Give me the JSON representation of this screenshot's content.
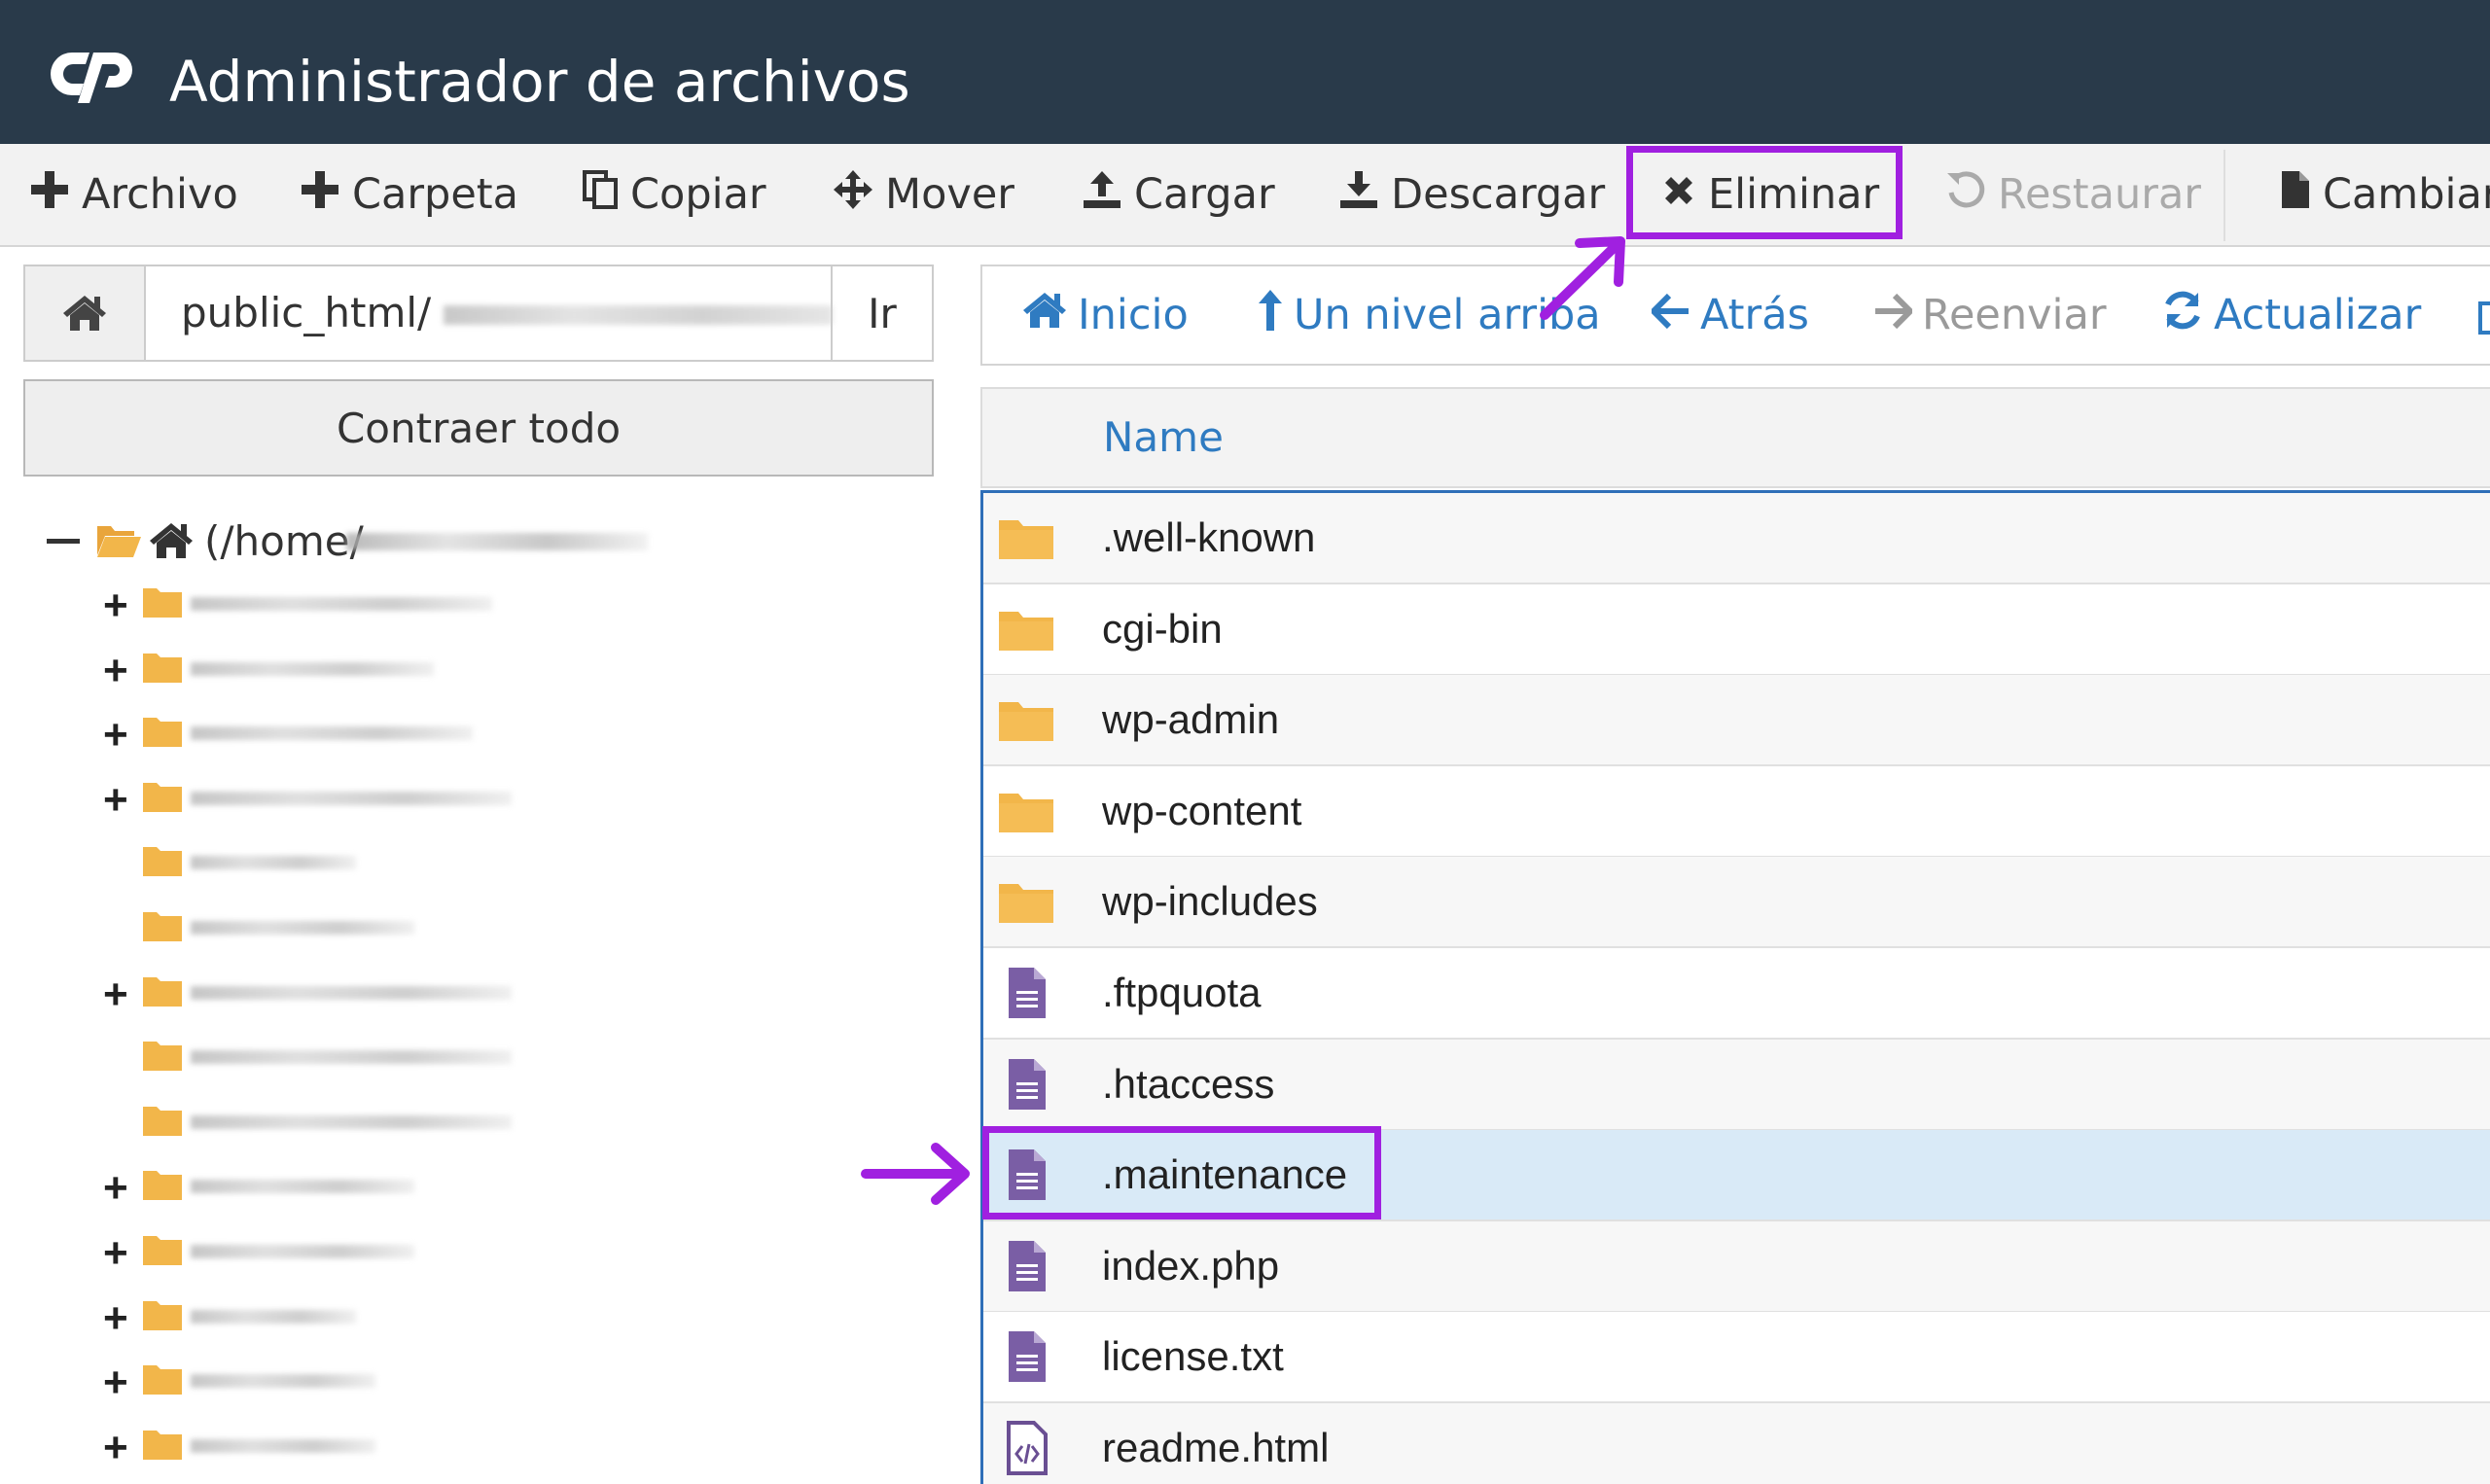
{
  "app": {
    "title": "Administrador de archivos",
    "logo_icon": "cpanel-logo",
    "header_color": "#293a4a",
    "accent_color": "#2f7bc1",
    "highlight_color": "#a020e0"
  },
  "toolbar": {
    "items": [
      {
        "label": "Archivo",
        "icon": "plus-icon",
        "enabled": true
      },
      {
        "label": "Carpeta",
        "icon": "plus-icon",
        "enabled": true
      },
      {
        "label": "Copiar",
        "icon": "copy-icon",
        "enabled": true
      },
      {
        "label": "Mover",
        "icon": "move-icon",
        "enabled": true
      },
      {
        "label": "Cargar",
        "icon": "upload-icon",
        "enabled": true
      },
      {
        "label": "Descargar",
        "icon": "download-icon",
        "enabled": true
      },
      {
        "label": "Eliminar",
        "icon": "close-icon",
        "enabled": true,
        "highlighted": true
      },
      {
        "label": "Restaurar",
        "icon": "undo-icon",
        "enabled": false
      },
      {
        "label": "Cambiar",
        "icon": "file-icon",
        "enabled": true
      }
    ]
  },
  "path_bar": {
    "home_icon": "home-icon",
    "value": "public_html/",
    "go_label": "Ir"
  },
  "tree": {
    "collapse_label": "Contraer todo",
    "root_label": "(/home/",
    "rows": [
      {
        "expandable": true
      },
      {
        "expandable": true
      },
      {
        "expandable": true
      },
      {
        "expandable": true
      },
      {
        "expandable": false
      },
      {
        "expandable": false
      },
      {
        "expandable": true
      },
      {
        "expandable": false
      },
      {
        "expandable": false
      },
      {
        "expandable": true
      },
      {
        "expandable": true
      },
      {
        "expandable": true
      },
      {
        "expandable": true
      },
      {
        "expandable": true
      }
    ]
  },
  "nav": {
    "items": [
      {
        "label": "Inicio",
        "icon": "home-icon",
        "enabled": true
      },
      {
        "label": "Un nivel arriba",
        "icon": "level-up-icon",
        "enabled": true
      },
      {
        "label": "Atrás",
        "icon": "arrow-left-icon",
        "enabled": true
      },
      {
        "label": "Reenviar",
        "icon": "arrow-right-icon",
        "enabled": false
      },
      {
        "label": "Actualizar",
        "icon": "refresh-icon",
        "enabled": true
      }
    ]
  },
  "table": {
    "column_name": "Name",
    "files": [
      {
        "name": ".well-known",
        "type": "folder"
      },
      {
        "name": "cgi-bin",
        "type": "folder"
      },
      {
        "name": "wp-admin",
        "type": "folder"
      },
      {
        "name": "wp-content",
        "type": "folder"
      },
      {
        "name": "wp-includes",
        "type": "folder"
      },
      {
        "name": ".ftpquota",
        "type": "text"
      },
      {
        "name": ".htaccess",
        "type": "text"
      },
      {
        "name": ".maintenance",
        "type": "text",
        "selected": true
      },
      {
        "name": "index.php",
        "type": "text"
      },
      {
        "name": "license.txt",
        "type": "text"
      },
      {
        "name": "readme.html",
        "type": "code"
      }
    ]
  }
}
